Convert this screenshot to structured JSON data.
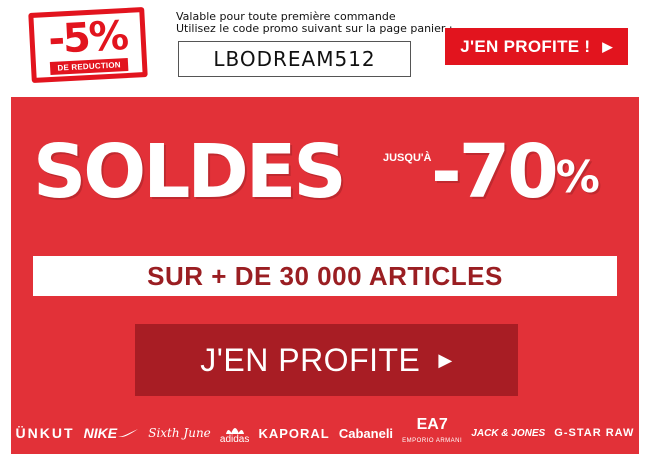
{
  "promo": {
    "stamp_value": "-5%",
    "stamp_label": "DE REDUCTION",
    "line1": "Valable pour toute première commande",
    "line2": "Utilisez le code promo suivant sur la page panier :",
    "code": "LBODREAM512",
    "cta_label": "J'EN PROFITE !"
  },
  "banner": {
    "title": "SOLDES",
    "upto": "JUSQU'À",
    "discount": "-70",
    "discount_unit": "%",
    "subtitle": "SUR + DE 30 000 ARTICLES",
    "cta_label": "J'EN PROFITE"
  },
  "brands": [
    "ÜNKUT",
    "NIKE",
    "Sixth June",
    "adidas",
    "KAPORAL",
    "Cabaneli",
    "EA7",
    "EMPORIO ARMANI",
    "JACK & JONES",
    "G-STAR RAW"
  ],
  "colors": {
    "accent": "#e2141e",
    "banner": "#e23138",
    "cta_dark": "#a81d24",
    "subtitle_text": "#9a1e22"
  },
  "icons": {
    "cta_arrow": "triangle-right-icon",
    "nike_swoosh": "nike-swoosh-icon",
    "adidas_trefoil": "adidas-trefoil-icon"
  }
}
